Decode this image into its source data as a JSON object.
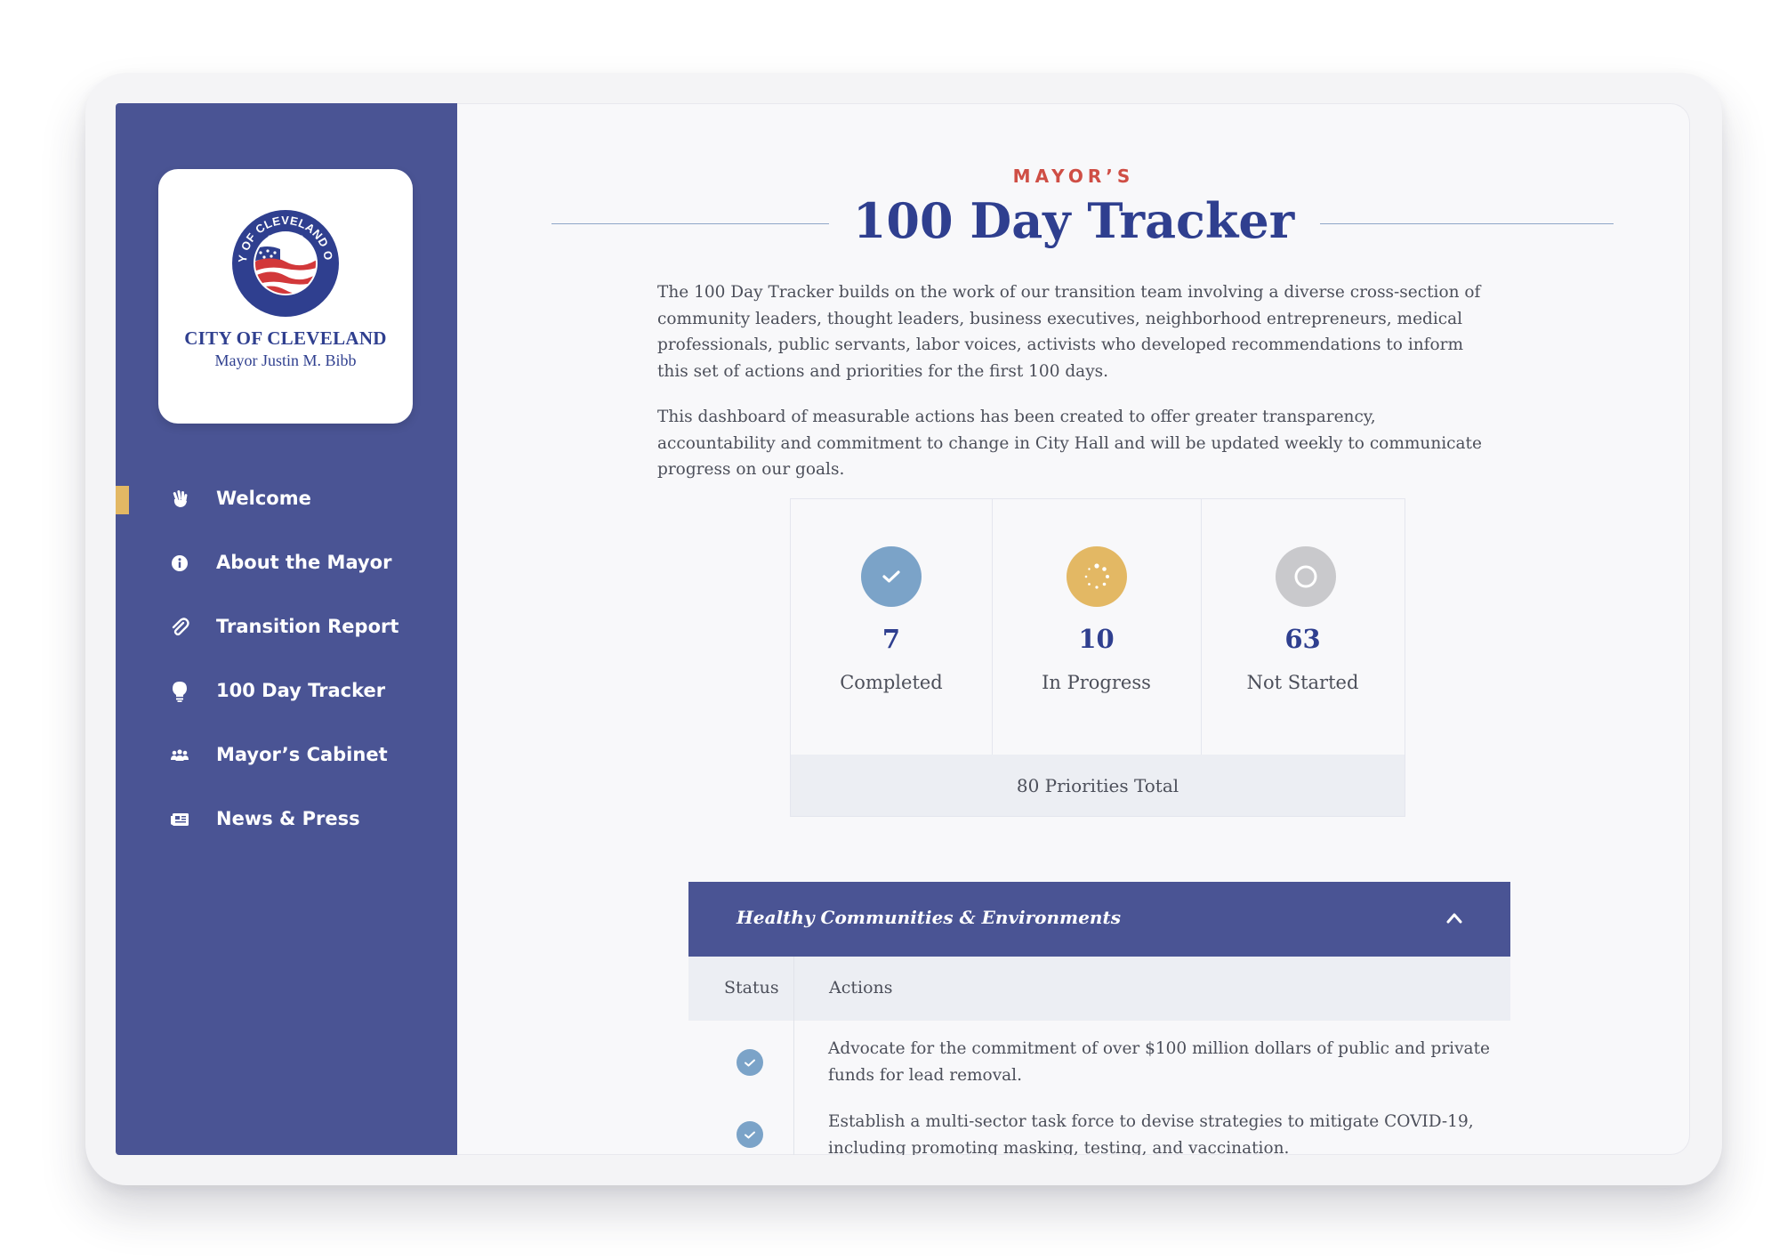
{
  "sidebar": {
    "logo": {
      "seal_text": "CITY OF CLEVELAND OHIO",
      "title": "CITY OF CLEVELAND",
      "subtitle": "Mayor Justin M. Bibb"
    },
    "active_index": 0,
    "items": [
      {
        "label": "Welcome",
        "icon": "wave-hand-icon"
      },
      {
        "label": "About the Mayor",
        "icon": "info-icon"
      },
      {
        "label": "Transition Report",
        "icon": "paperclip-icon"
      },
      {
        "label": "100 Day Tracker",
        "icon": "lightbulb-icon"
      },
      {
        "label": "Mayor’s Cabinet",
        "icon": "people-icon"
      },
      {
        "label": "News & Press",
        "icon": "newspaper-icon"
      }
    ]
  },
  "header": {
    "kicker": "MAYOR’S",
    "title": "100 Day Tracker"
  },
  "intro": {
    "paragraph_1": "The 100 Day Tracker builds on the work of our transition team involving a diverse cross-section of community leaders, thought leaders, business executives, neighborhood entrepreneurs, medical professionals, public servants, labor voices, activists who developed recommendations to inform this set of actions and priorities for the first 100 days.",
    "paragraph_2": "This dashboard of measurable actions has been created to offer greater transparency, accountability and commitment to change in City Hall and will be updated weekly to communicate progress on our goals."
  },
  "stats": {
    "items": [
      {
        "count": "7",
        "label": "Completed",
        "icon": "check-circle-icon",
        "color": "#7ba3c8"
      },
      {
        "count": "10",
        "label": "In Progress",
        "icon": "spinner-icon",
        "color": "#e3b864"
      },
      {
        "count": "63",
        "label": "Not Started",
        "icon": "empty-circle-icon",
        "color": "#c9c9cc"
      }
    ],
    "total": "80 Priorities Total"
  },
  "accordion": {
    "title": "Healthy Communities & Environments",
    "expanded": true,
    "columns": [
      "Status",
      "Actions"
    ],
    "rows": [
      {
        "status": "completed",
        "action": "Advocate for the commitment of over $100 million dollars of public and private funds for lead removal."
      },
      {
        "status": "completed",
        "action": "Establish a multi-sector task force to devise strategies to mitigate COVID-19, including promoting masking, testing, and vaccination."
      }
    ]
  },
  "colors": {
    "brand_blue": "#4a5494",
    "title_blue": "#2f3f8f",
    "accent_red": "#cf4e45",
    "accent_gold": "#e3b864"
  },
  "accessibility_button": {
    "icon": "accessibility-icon"
  }
}
